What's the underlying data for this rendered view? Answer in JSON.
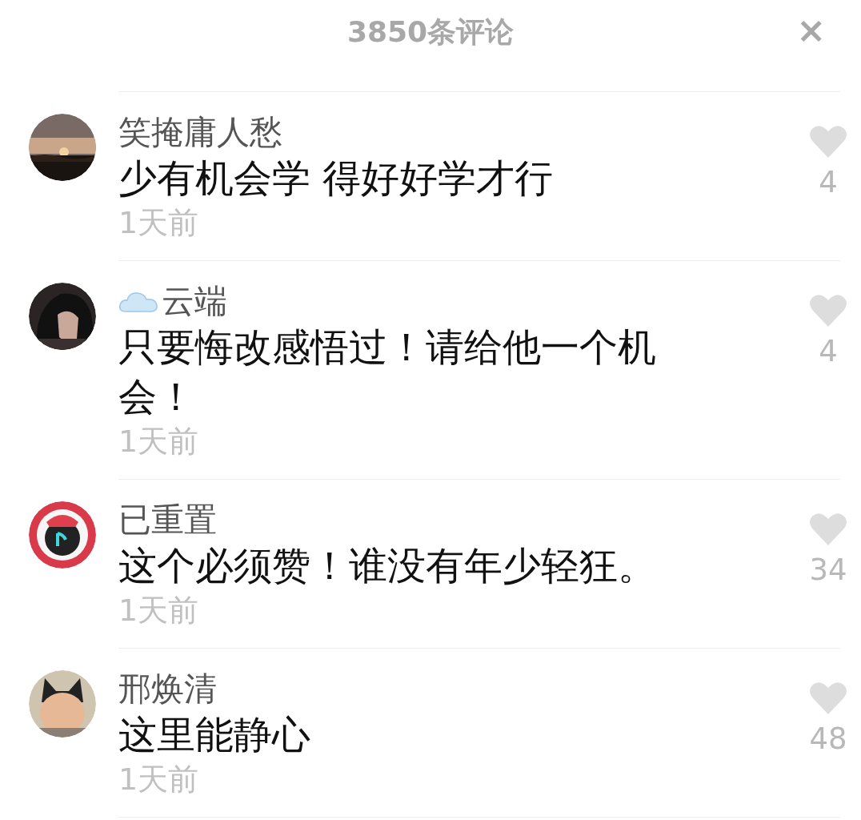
{
  "header": {
    "title": "3850条评论",
    "close": "×"
  },
  "comments": [
    {
      "name": "笑掩庸人愁",
      "cloud_emoji": false,
      "text": "少有机会学 得好好学才行",
      "time": "1天前",
      "likes": "4",
      "liked": false
    },
    {
      "name": "云端",
      "cloud_emoji": true,
      "text": "只要悔改感悟过！请给他一个机会！",
      "time": "1天前",
      "likes": "4",
      "liked": false
    },
    {
      "name": "已重置",
      "cloud_emoji": false,
      "text": "这个必须赞！谁没有年少轻狂。",
      "time": "1天前",
      "likes": "34",
      "liked": false
    },
    {
      "name": "邢焕清",
      "cloud_emoji": false,
      "text": "这里能静心",
      "time": "1天前",
      "likes": "48",
      "liked": false
    }
  ]
}
